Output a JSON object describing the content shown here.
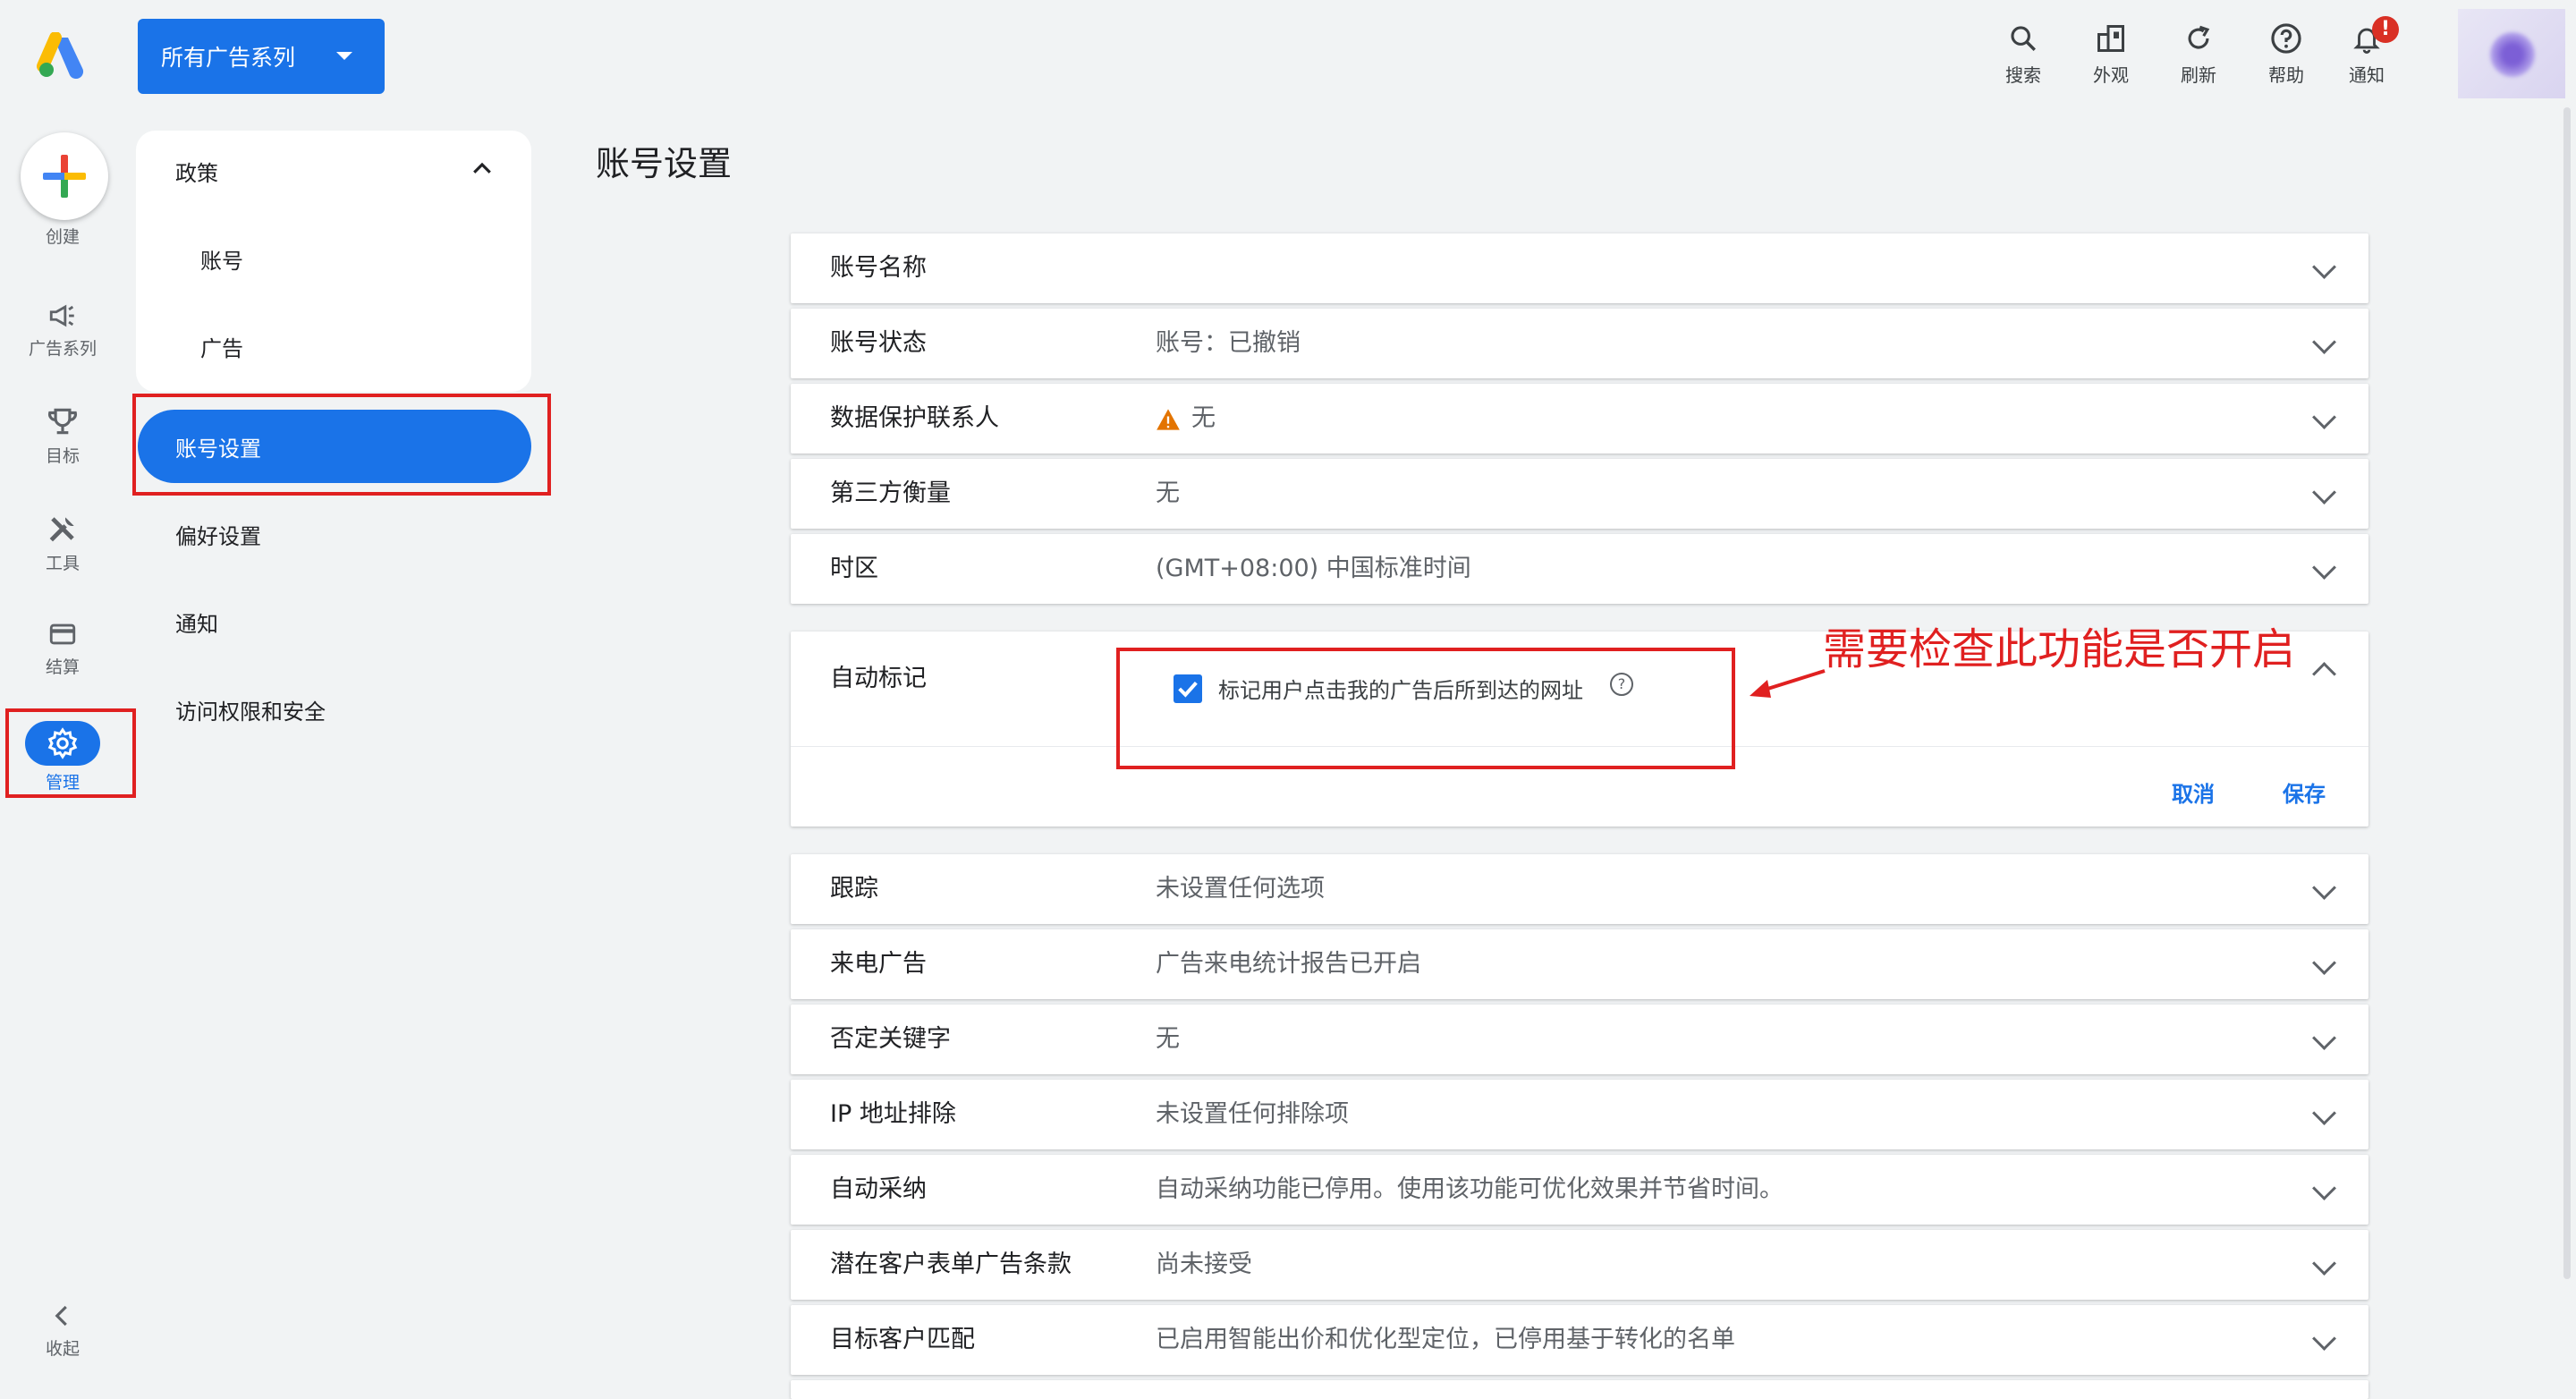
{
  "header": {
    "campaign_selector": "所有广告系列",
    "tools": [
      {
        "name": "search-icon",
        "label": "搜索"
      },
      {
        "name": "appearance-icon",
        "label": "外观"
      },
      {
        "name": "refresh-icon",
        "label": "刷新"
      },
      {
        "name": "help-icon",
        "label": "帮助"
      },
      {
        "name": "bell-icon",
        "label": "通知",
        "badge": "!"
      }
    ]
  },
  "rail": {
    "create": "创建",
    "campaigns": "广告系列",
    "goals": "目标",
    "tools": "工具",
    "billing": "结算",
    "admin": "管理",
    "collapse": "收起"
  },
  "nav": {
    "policy": "政策",
    "account": "账号",
    "ads": "广告",
    "account_settings": "账号设置",
    "preferences": "偏好设置",
    "notifications": "通知",
    "access_security": "访问权限和安全"
  },
  "page": {
    "title": "账号设置"
  },
  "settings": {
    "rows_top": [
      {
        "label": "账号名称",
        "value": ""
      },
      {
        "label": "账号状态",
        "value": "账号：已撤销"
      },
      {
        "label": "数据保护联系人",
        "value": "无",
        "warning": true
      },
      {
        "label": "第三方衡量",
        "value": "无"
      },
      {
        "label": "时区",
        "value": "(GMT+08:00) 中国标准时间"
      }
    ],
    "auto_tagging": {
      "label": "自动标记",
      "checkbox_label": "标记用户点击我的广告后所到达的网址",
      "checked": true,
      "cancel": "取消",
      "save": "保存"
    },
    "rows_bottom": [
      {
        "label": "跟踪",
        "value": "未设置任何选项"
      },
      {
        "label": "来电广告",
        "value": "广告来电统计报告已开启"
      },
      {
        "label": "否定关键字",
        "value": "无"
      },
      {
        "label": "IP 地址排除",
        "value": "未设置任何排除项"
      },
      {
        "label": "自动采纳",
        "value": "自动采纳功能已停用。使用该功能可优化效果并节省时间。"
      },
      {
        "label": "潜在客户表单广告条款",
        "value": "尚未接受"
      },
      {
        "label": "目标客户匹配",
        "value": "已启用智能出价和优化型定位，已停用基于转化的名单"
      }
    ]
  },
  "annotation": "需要检查此功能是否开启",
  "colors": {
    "brand_blue": "#1a73e8",
    "annotation_red": "#e02020",
    "warning_orange": "#e37400"
  }
}
